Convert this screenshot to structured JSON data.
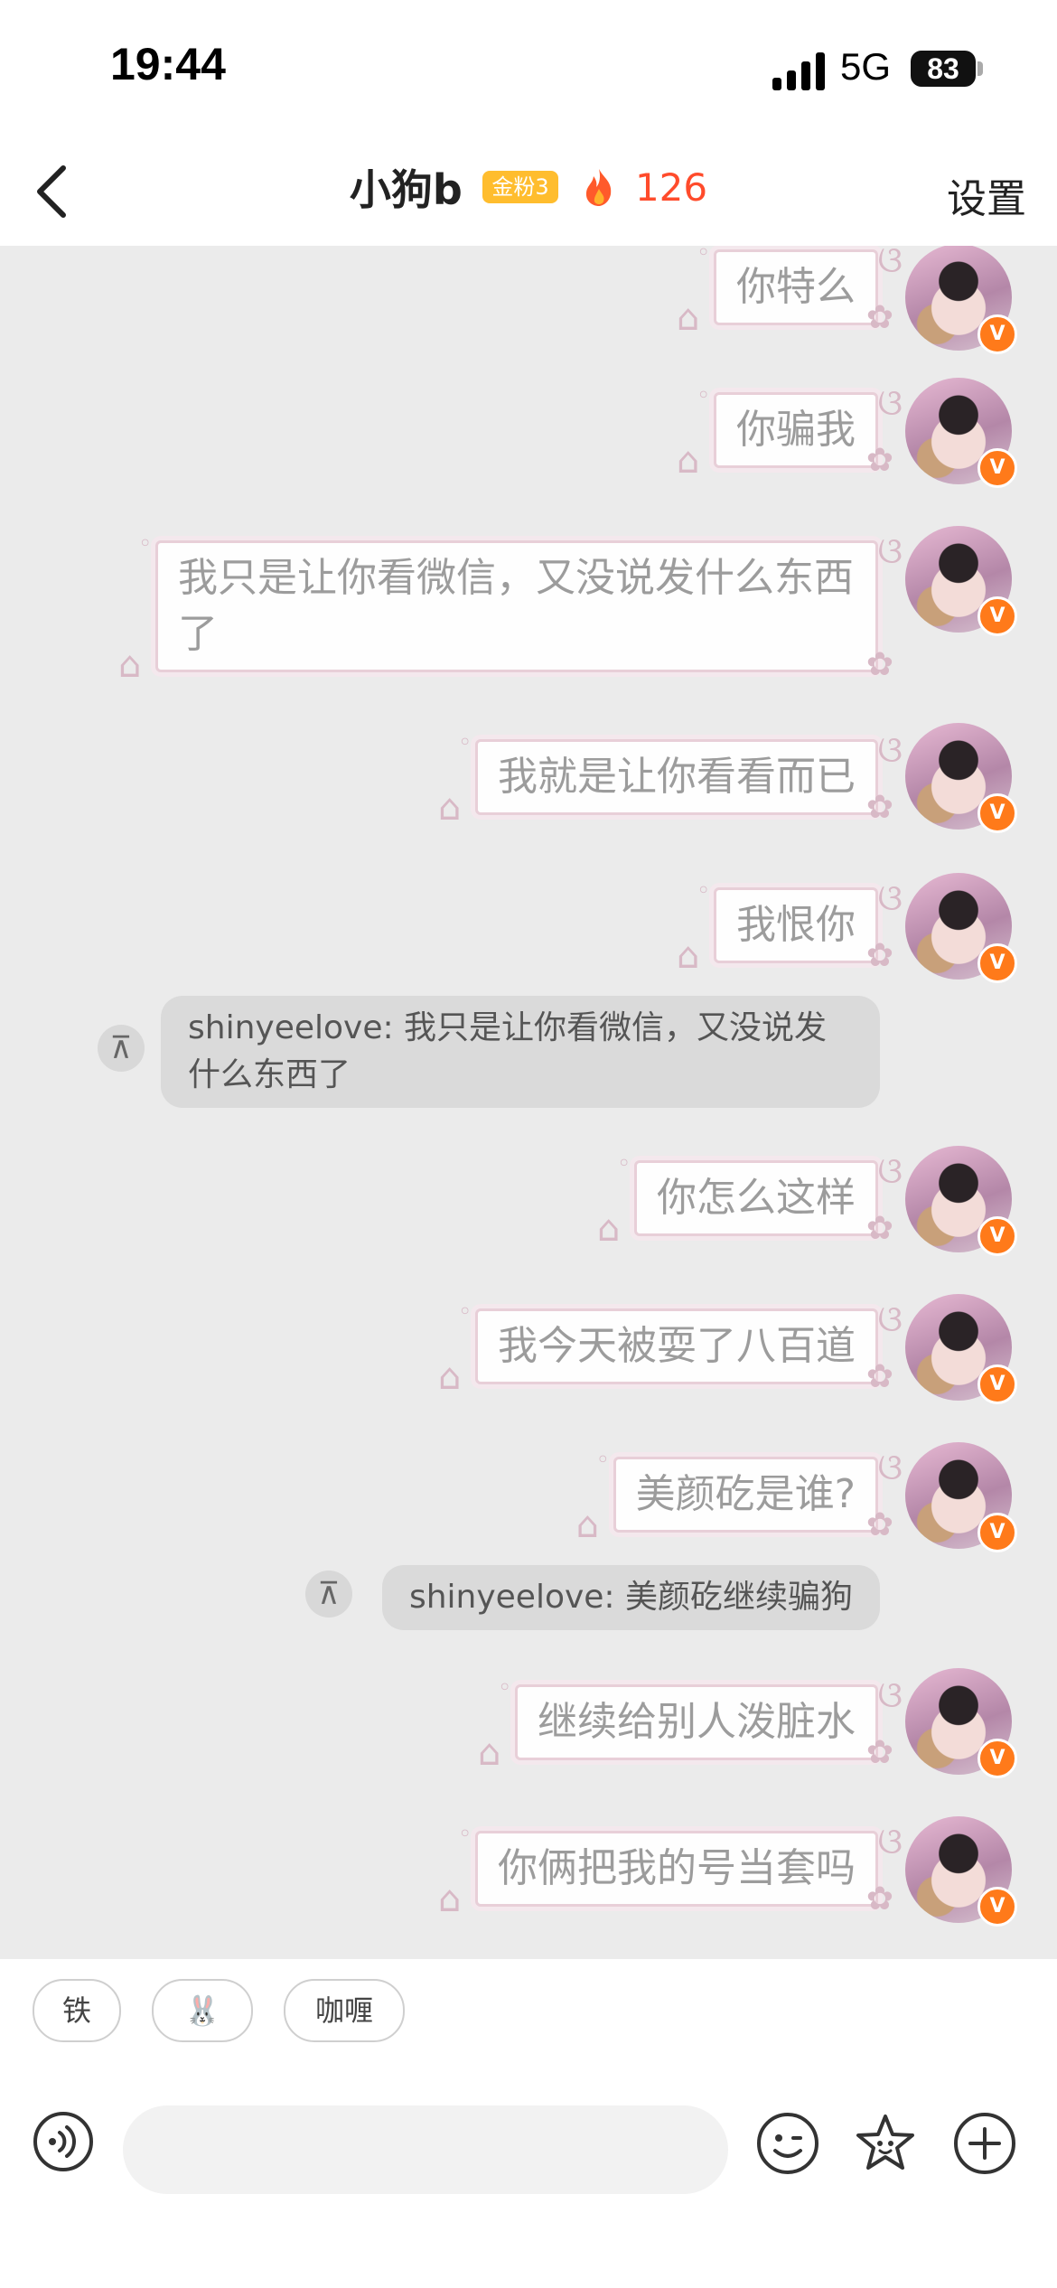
{
  "status_bar": {
    "time": "19:44",
    "network": "5G",
    "battery": "83"
  },
  "header": {
    "title": "小狗b",
    "badge": "金粉3",
    "fire_count": "126",
    "settings_label": "设置"
  },
  "messages": [
    {
      "type": "sent",
      "text": "你特么"
    },
    {
      "type": "sent",
      "text": "你骗我"
    },
    {
      "type": "sent",
      "text": "我只是让你看微信，又没说发什么东西了"
    },
    {
      "type": "sent",
      "text": "我就是让你看看而已"
    },
    {
      "type": "sent",
      "text": "我恨你"
    },
    {
      "type": "quote",
      "text": "shinyeelove: 我只是让你看微信，又没说发什么东西了"
    },
    {
      "type": "sent",
      "text": "你怎么这样"
    },
    {
      "type": "sent",
      "text": "我今天被耍了八百道"
    },
    {
      "type": "sent",
      "text": "美颜矻是谁?"
    },
    {
      "type": "quote",
      "text": "shinyeelove: 美颜矻继续骗狗"
    },
    {
      "type": "sent",
      "text": "继续给别人泼脏水"
    },
    {
      "type": "sent",
      "text": "你俩把我的号当套吗"
    }
  ],
  "avatar_badge": "V",
  "quick_replies": [
    "铁",
    "🐰",
    "咖喱"
  ],
  "input": {
    "placeholder": ""
  },
  "icons": [
    "back-arrow-icon",
    "voice-icon",
    "emoji-icon",
    "sticker-icon",
    "plus-icon"
  ],
  "colors": {
    "accent_fire": "#ff4b2b",
    "badge": "#ffbd2e",
    "verified": "#ff7a1a"
  }
}
